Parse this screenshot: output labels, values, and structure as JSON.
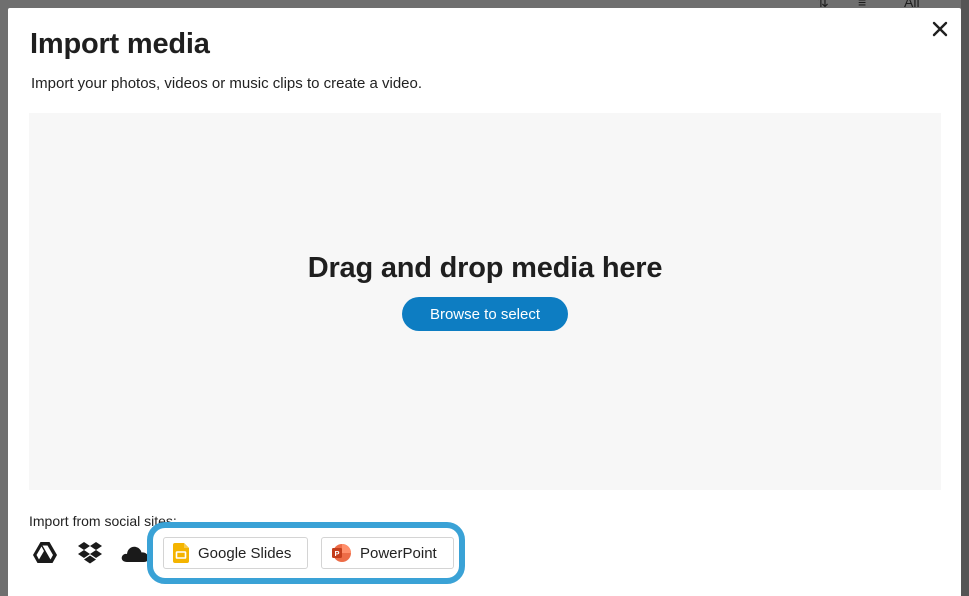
{
  "modal": {
    "title": "Import media",
    "subtitle": "Import your photos, videos or music clips to create a video.",
    "close_icon": "close-icon"
  },
  "dropzone": {
    "heading": "Drag and drop media here",
    "browse_label": "Browse to select"
  },
  "social": {
    "label": "Import from social sites:",
    "icons": [
      "google-drive-icon",
      "dropbox-icon",
      "onedrive-icon"
    ]
  },
  "imports": {
    "google_slides_label": "Google Slides",
    "powerpoint_label": "PowerPoint"
  },
  "background": {
    "toolbar_partial": "All"
  },
  "colors": {
    "accent": "#0d7dc2",
    "highlight": "#3aa2d6",
    "dropzone_bg": "#f7f7f7",
    "google_slides": "#f4b400",
    "powerpoint": "#d24726"
  }
}
